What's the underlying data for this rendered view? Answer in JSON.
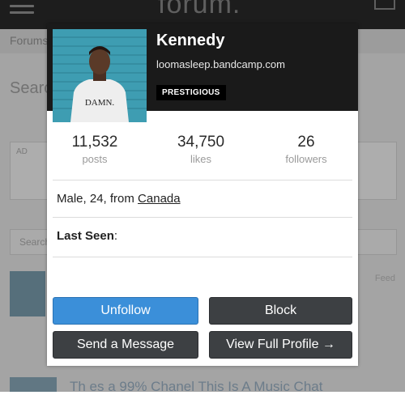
{
  "background": {
    "logo": "forum.",
    "breadcrumb": "Forums",
    "search_title": "Search",
    "box_text": "AD",
    "input_placeholder": "Search",
    "thread_title": "Th es a 99% Chanel This Is A Music Chat",
    "side_text": "Feed"
  },
  "profile": {
    "username": "Kennedy",
    "website": "loomasleep.bandcamp.com",
    "badge": "PRESTIGIOUS",
    "stats": [
      {
        "value": "11,532",
        "label": "posts"
      },
      {
        "value": "34,750",
        "label": "likes"
      },
      {
        "value": "26",
        "label": "followers"
      }
    ],
    "info_prefix": "Male, 24, from ",
    "location": "Canada",
    "last_seen_label": "Last Seen",
    "last_seen_colon": ":",
    "buttons": {
      "unfollow": "Unfollow",
      "block": "Block",
      "message": "Send a Message",
      "full_profile": "View Full Profile →"
    }
  },
  "colors": {
    "header_bg": "#1a1a1a",
    "primary_button": "#3b8fd9",
    "secondary_button": "#3d4043",
    "badge_bg": "#000000"
  }
}
